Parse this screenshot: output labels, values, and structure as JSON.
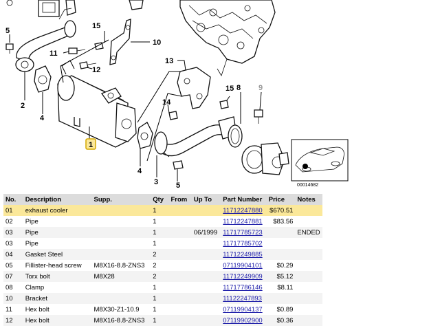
{
  "diagram": {
    "callouts": {
      "c1": "1",
      "c2": "2",
      "c4a": "4",
      "c4b": "4",
      "c3": "3",
      "c5a": "5",
      "c5b": "5",
      "c8": "8",
      "c9": "9",
      "c10": "10",
      "c11": "11",
      "c12": "12",
      "c13": "13",
      "c14": "14",
      "c15": "15"
    },
    "ref_number": "00014682"
  },
  "table": {
    "headers": {
      "no": "No.",
      "description": "Description",
      "supp": "Supp.",
      "qty": "Qty",
      "from": "From",
      "upto": "Up To",
      "part_number": "Part Number",
      "price": "Price",
      "notes": "Notes"
    },
    "rows": [
      {
        "no": "01",
        "description": "exhaust cooler",
        "supp": "",
        "qty": "1",
        "from": "",
        "upto": "",
        "part_number": "11712247880",
        "price": "$670.51",
        "notes": ""
      },
      {
        "no": "02",
        "description": "Pipe",
        "supp": "",
        "qty": "1",
        "from": "",
        "upto": "",
        "part_number": "11712247881",
        "price": "$83.56",
        "notes": ""
      },
      {
        "no": "03",
        "description": "Pipe",
        "supp": "",
        "qty": "1",
        "from": "",
        "upto": "06/1999",
        "part_number": "11717785723",
        "price": "",
        "notes": "ENDED"
      },
      {
        "no": "03",
        "description": "Pipe",
        "supp": "",
        "qty": "1",
        "from": "",
        "upto": "",
        "part_number": "11717785702",
        "price": "",
        "notes": ""
      },
      {
        "no": "04",
        "description": "Gasket Steel",
        "supp": "",
        "qty": "2",
        "from": "",
        "upto": "",
        "part_number": "11712249885",
        "price": "",
        "notes": ""
      },
      {
        "no": "05",
        "description": "Fillister-head screw",
        "supp": "M8X16-8.8-ZNS3",
        "qty": "2",
        "from": "",
        "upto": "",
        "part_number": "07119904101",
        "price": "$0.29",
        "notes": ""
      },
      {
        "no": "07",
        "description": "Torx bolt",
        "supp": "M8X28",
        "qty": "2",
        "from": "",
        "upto": "",
        "part_number": "11712249909",
        "price": "$5.12",
        "notes": ""
      },
      {
        "no": "08",
        "description": "Clamp",
        "supp": "",
        "qty": "1",
        "from": "",
        "upto": "",
        "part_number": "11717786146",
        "price": "$8.11",
        "notes": ""
      },
      {
        "no": "10",
        "description": "Bracket",
        "supp": "",
        "qty": "1",
        "from": "",
        "upto": "",
        "part_number": "11122247893",
        "price": "",
        "notes": ""
      },
      {
        "no": "11",
        "description": "Hex bolt",
        "supp": "M8X30-Z1-10.9",
        "qty": "1",
        "from": "",
        "upto": "",
        "part_number": "07119904137",
        "price": "$0.89",
        "notes": ""
      },
      {
        "no": "12",
        "description": "Hex bolt",
        "supp": "M8X16-8.8-ZNS3",
        "qty": "1",
        "from": "",
        "upto": "",
        "part_number": "07119902900",
        "price": "$0.36",
        "notes": ""
      }
    ]
  }
}
